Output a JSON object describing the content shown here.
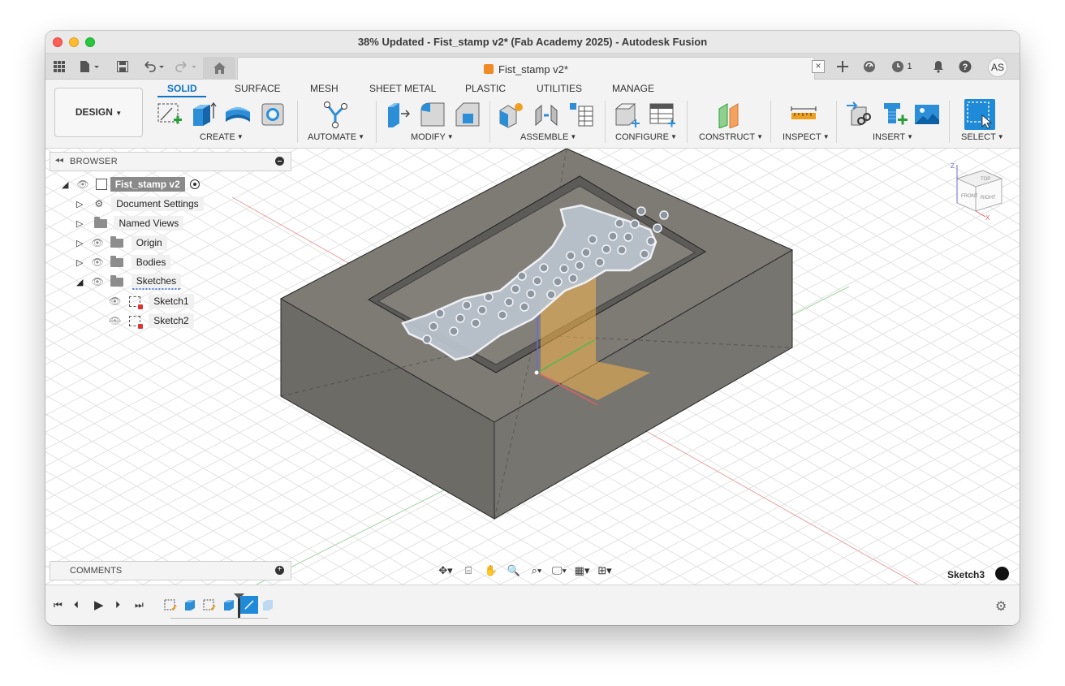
{
  "window": {
    "title": "38% Updated - Fist_stamp v2* (Fab Academy 2025) - Autodesk Fusion"
  },
  "tabbar": {
    "doc_tab_label": "Fist_stamp v2*",
    "close_glyph": "×",
    "jobs_count": "1",
    "avatar_initials": "AS",
    "icons": [
      "grid-icon",
      "file-icon",
      "save-icon",
      "undo-icon",
      "redo-icon",
      "home-icon",
      "plus-icon",
      "offline-icon",
      "clock-icon",
      "bell-icon",
      "help-icon"
    ]
  },
  "ribbon": {
    "workspace": "DESIGN",
    "tabs": [
      "SOLID",
      "SURFACE",
      "MESH",
      "SHEET METAL",
      "PLASTIC",
      "UTILITIES",
      "MANAGE"
    ],
    "active_tab": "SOLID",
    "groups": [
      "CREATE",
      "AUTOMATE",
      "MODIFY",
      "ASSEMBLE",
      "CONFIGURE",
      "CONSTRUCT",
      "INSPECT",
      "INSERT",
      "SELECT"
    ],
    "accent_color": "#0f74c9"
  },
  "browser": {
    "title": "BROWSER",
    "root": "Fist_stamp v2",
    "nodes": [
      "Document Settings",
      "Named Views",
      "Origin",
      "Bodies",
      "Sketches"
    ],
    "sketches": [
      "Sketch1",
      "Sketch2"
    ]
  },
  "comments": {
    "title": "COMMENTS"
  },
  "viewport": {
    "active_sketch": "Sketch3",
    "viewcube_faces": [
      "TOP",
      "FRONT",
      "RIGHT"
    ],
    "axis_labels": [
      "Z",
      "X"
    ]
  },
  "timeline": {
    "controls": [
      "skip-start",
      "step-back",
      "play",
      "step-forward",
      "skip-end"
    ]
  }
}
